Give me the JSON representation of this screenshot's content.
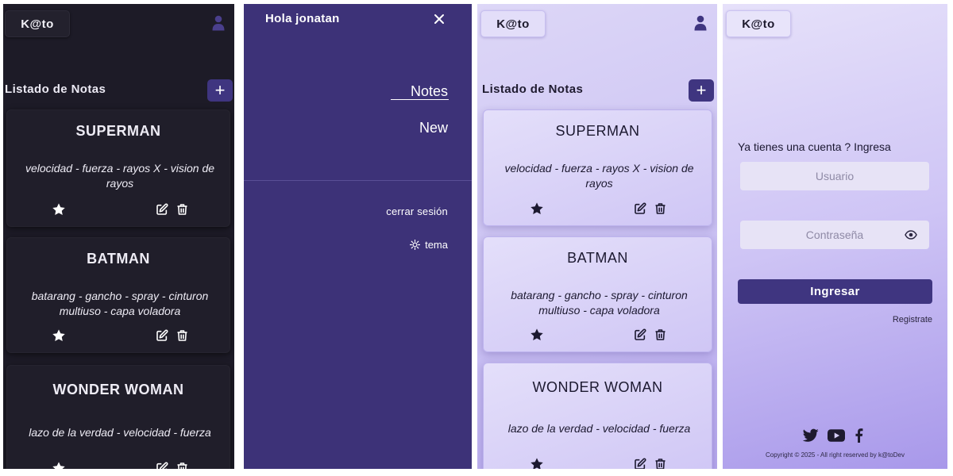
{
  "dark_view": {
    "logo": "K@to",
    "list_title": "Listado de Notas",
    "add_label": "+",
    "notes": [
      {
        "title": "SUPERMAN",
        "body": "velocidad - fuerza - rayos X - vision de rayos"
      },
      {
        "title": "BATMAN",
        "body": "batarang - gancho - spray - cinturon multiuso - capa voladora"
      },
      {
        "title": "WONDER WOMAN",
        "body": "lazo de la verdad - velocidad - fuerza"
      }
    ]
  },
  "drawer": {
    "greeting": "Hola jonatan",
    "nav": {
      "notes": "Notes",
      "new": "New"
    },
    "logout": "cerrar sesión",
    "theme": "tema"
  },
  "light_view": {
    "logo": "K@to",
    "list_title": "Listado de Notas",
    "add_label": "+",
    "notes": [
      {
        "title": "SUPERMAN",
        "body": "velocidad - fuerza - rayos X - vision de rayos"
      },
      {
        "title": "BATMAN",
        "body": "batarang - gancho - spray - cinturon multiuso - capa voladora"
      },
      {
        "title": "WONDER WOMAN",
        "body": "lazo de la verdad - velocidad - fuerza"
      }
    ]
  },
  "login_view": {
    "logo": "K@to",
    "prompt": "Ya tienes una cuenta ? Ingresa",
    "username_placeholder": "Usuario",
    "password_placeholder": "Contraseña",
    "login_button": "Ingresar",
    "register_link": "Registrate",
    "social_icons": [
      "twitter-icon",
      "youtube-icon",
      "facebook-icon"
    ],
    "copyright": "Copyright © 2025 - All right reserved by k@toDev"
  },
  "colors": {
    "dark_bg": "#1d1b27",
    "dark_card": "#201e2a",
    "accent": "#3f3580",
    "drawer_bg": "#3d3278",
    "light_bg": "#cbc2f3"
  }
}
